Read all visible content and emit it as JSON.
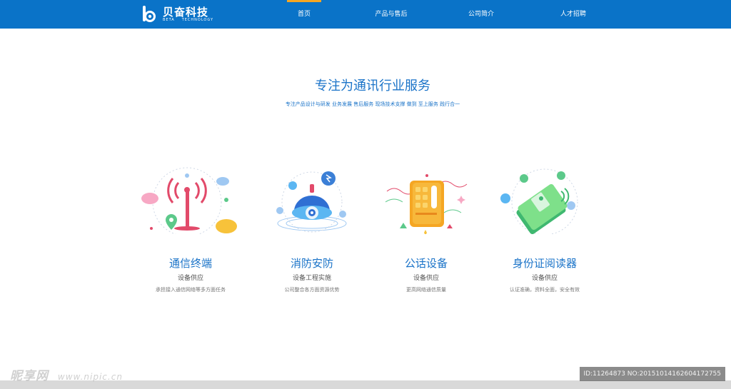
{
  "header": {
    "logo_title": "贝奋科技",
    "logo_sub_left": "BETA",
    "logo_sub_right": "TECHNOLOGY",
    "bg_color": "#0a73c8",
    "active_indicator_color": "#f5a623"
  },
  "nav": {
    "items": [
      {
        "label": "首页"
      },
      {
        "label": "产品与售后"
      },
      {
        "label": "公司简介"
      },
      {
        "label": "人才招聘"
      }
    ]
  },
  "hero": {
    "title": "专注为通讯行业服务",
    "subtitle": "专注产品设计与研发  业务发展  售后服务  现场技术支撑  做到 至上服务  践行合一"
  },
  "services": [
    {
      "title": "通信终端",
      "sub": "设备供应",
      "desc": "承担接入通信网络等多方面任务",
      "icon": "antenna-icon"
    },
    {
      "title": "消防安防",
      "sub": "设备工程实施",
      "desc": "公司整合各方面资源优势",
      "icon": "security-camera-icon"
    },
    {
      "title": "公话设备",
      "sub": "设备供应",
      "desc": "更高网络通信质量",
      "icon": "payphone-icon"
    },
    {
      "title": "身份证阅读器",
      "sub": "设备供应",
      "desc": "认证准确，资料全面，安全有效",
      "icon": "id-card-reader-icon"
    }
  ],
  "watermark": {
    "brand": "昵享网",
    "url": "www.nipic.cn",
    "id_text": "ID:11264873 NO:20151014162604172755"
  }
}
